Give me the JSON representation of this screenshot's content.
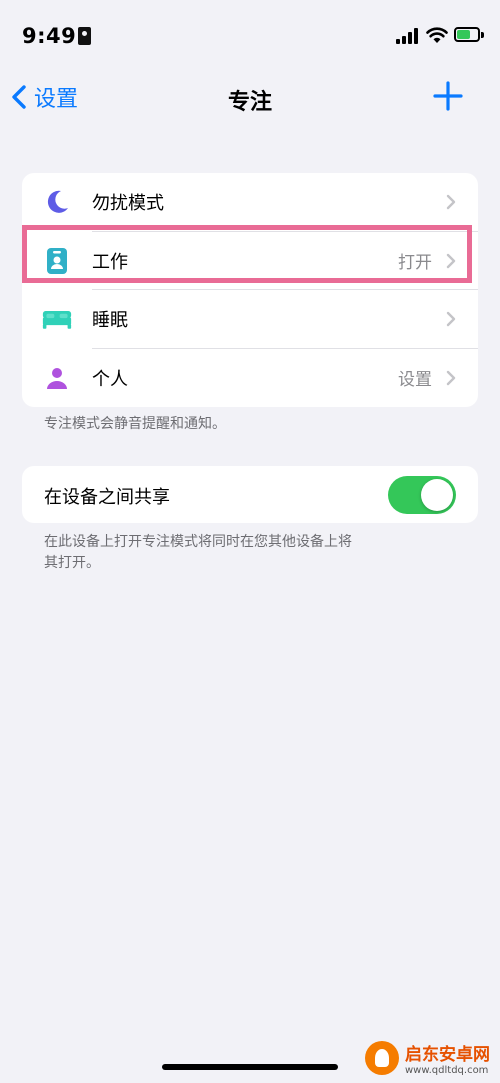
{
  "status_bar": {
    "time": "9:49"
  },
  "nav": {
    "back_label": "设置",
    "title": "专注"
  },
  "focus_modes": [
    {
      "label": "勿扰模式",
      "detail": "",
      "icon": "moon-icon",
      "color": "#5e5ce6"
    },
    {
      "label": "工作",
      "detail": "打开",
      "icon": "id-badge-icon",
      "color": "#30b0c7"
    },
    {
      "label": "睡眠",
      "detail": "",
      "icon": "bed-icon",
      "color": "#30d1b8"
    },
    {
      "label": "个人",
      "detail": "设置",
      "icon": "person-icon",
      "color": "#af52de"
    }
  ],
  "focus_footnote": "专注模式会静音提醒和通知。",
  "share": {
    "label": "在设备之间共享",
    "enabled": true,
    "footnote_line1": "在此设备上打开专注模式将同时在您其他设备上将",
    "footnote_line2": "其打开。"
  },
  "watermark": {
    "title": "启东安卓网",
    "url": "www.qdltdq.com"
  },
  "colors": {
    "accent": "#0a7aff",
    "toggle_on": "#34c759",
    "highlight": "#e96b95",
    "background": "#f2f2f7"
  }
}
